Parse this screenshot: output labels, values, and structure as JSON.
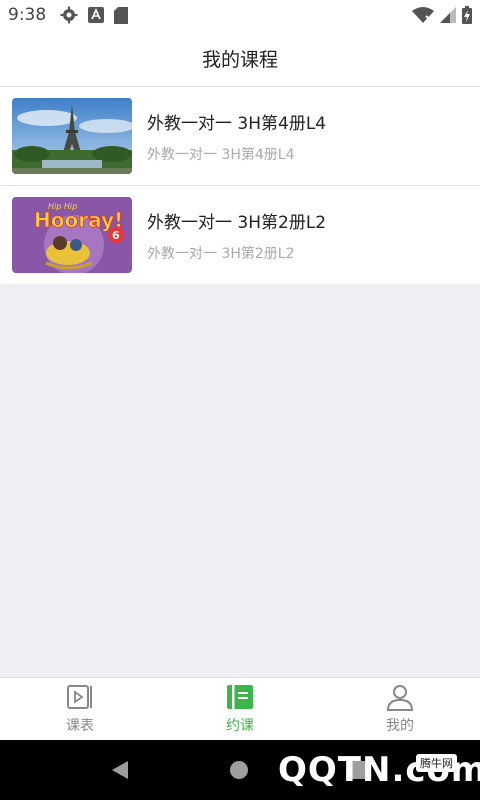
{
  "status_bar": {
    "time": "9:38"
  },
  "header": {
    "title": "我的课程"
  },
  "courses": [
    {
      "title": "外教一对一 3H第4册L4",
      "subtitle": "外教一对一 3H第4册L4",
      "thumb": "eiffel-tower-photo"
    },
    {
      "title": "外教一对一 3H第2册L2",
      "subtitle": "外教一对一 3H第2册L2",
      "thumb": "hooray-book-cover",
      "cover_title": "Hooray!",
      "cover_num": "6"
    }
  ],
  "tabs": [
    {
      "label": "课表",
      "icon": "video-schedule-icon",
      "active": false
    },
    {
      "label": "约课",
      "icon": "book-icon",
      "active": true
    },
    {
      "label": "我的",
      "icon": "person-icon",
      "active": false
    }
  ],
  "watermark": {
    "text": "QQTN.com",
    "badge": "腾牛网"
  },
  "colors": {
    "accent": "#3cb54a",
    "background": "#efeff4"
  }
}
